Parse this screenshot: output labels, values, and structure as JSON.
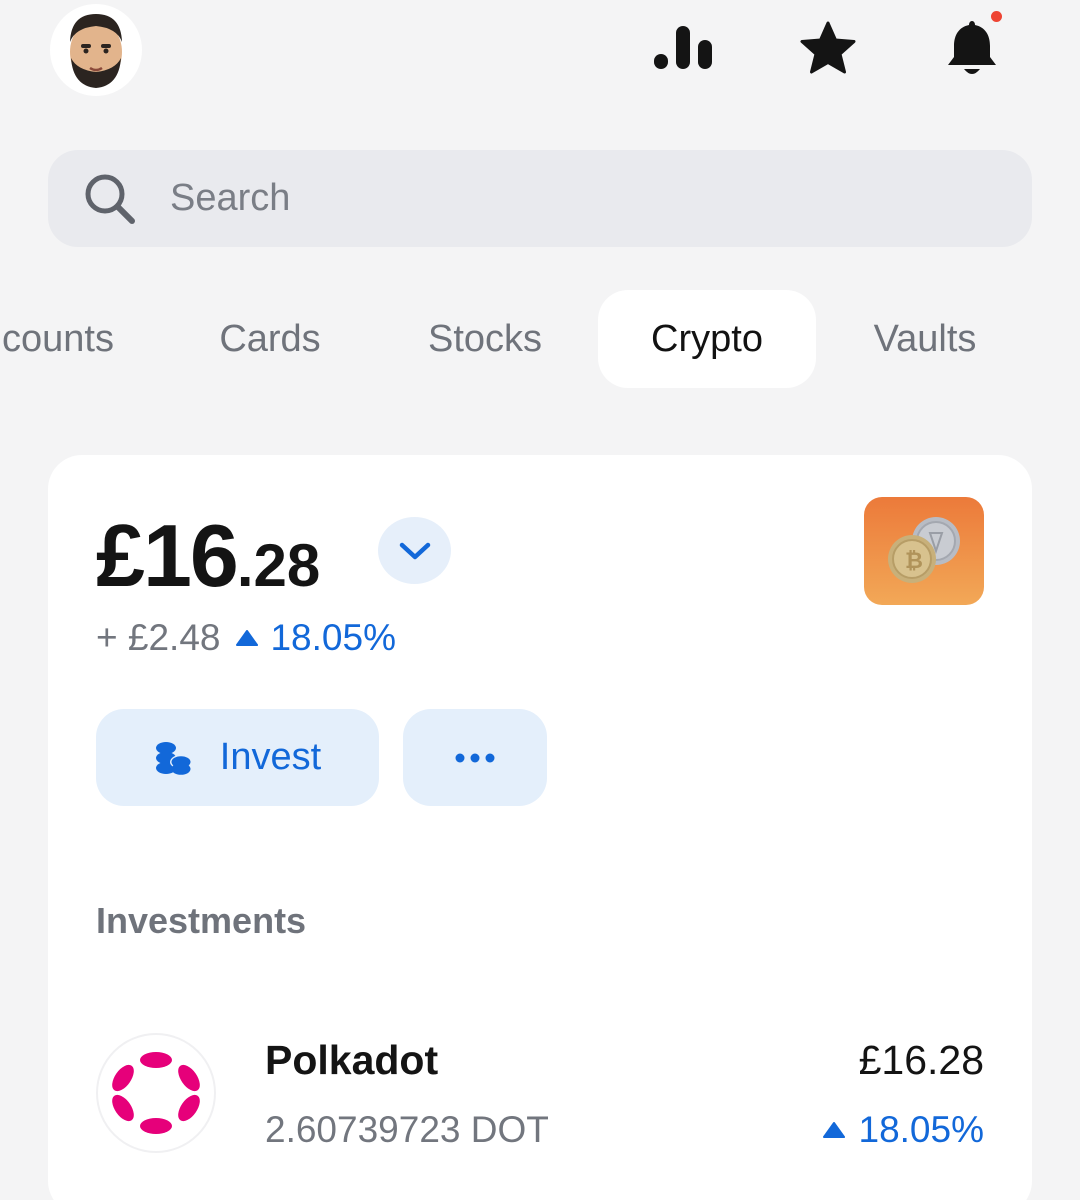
{
  "header": {
    "avatar_icon": "user-avatar",
    "icons": [
      "bar-chart-icon",
      "star-icon",
      "bell-icon"
    ],
    "has_notification": true
  },
  "search": {
    "placeholder": "Search",
    "value": ""
  },
  "tabs": [
    {
      "label": "counts"
    },
    {
      "label": "Cards"
    },
    {
      "label": "Stocks"
    },
    {
      "label": "Crypto",
      "active": true
    },
    {
      "label": "Vaults"
    }
  ],
  "balance": {
    "whole": "£16",
    "fraction": ".28",
    "change_abs": "+ £2.48",
    "change_pct": "18.05%"
  },
  "actions": {
    "invest_label": "Invest",
    "more_label": "···"
  },
  "investments": {
    "title": "Investments",
    "items": [
      {
        "name": "Polkadot",
        "quantity": "2.60739723 DOT",
        "value": "£16.28",
        "change_pct": "18.05%",
        "icon": "polkadot-logo"
      }
    ]
  },
  "colors": {
    "accent": "#1268d9",
    "accent_bg": "#e4effb",
    "notification": "#ee4433",
    "polkadot": "#e6007a"
  }
}
